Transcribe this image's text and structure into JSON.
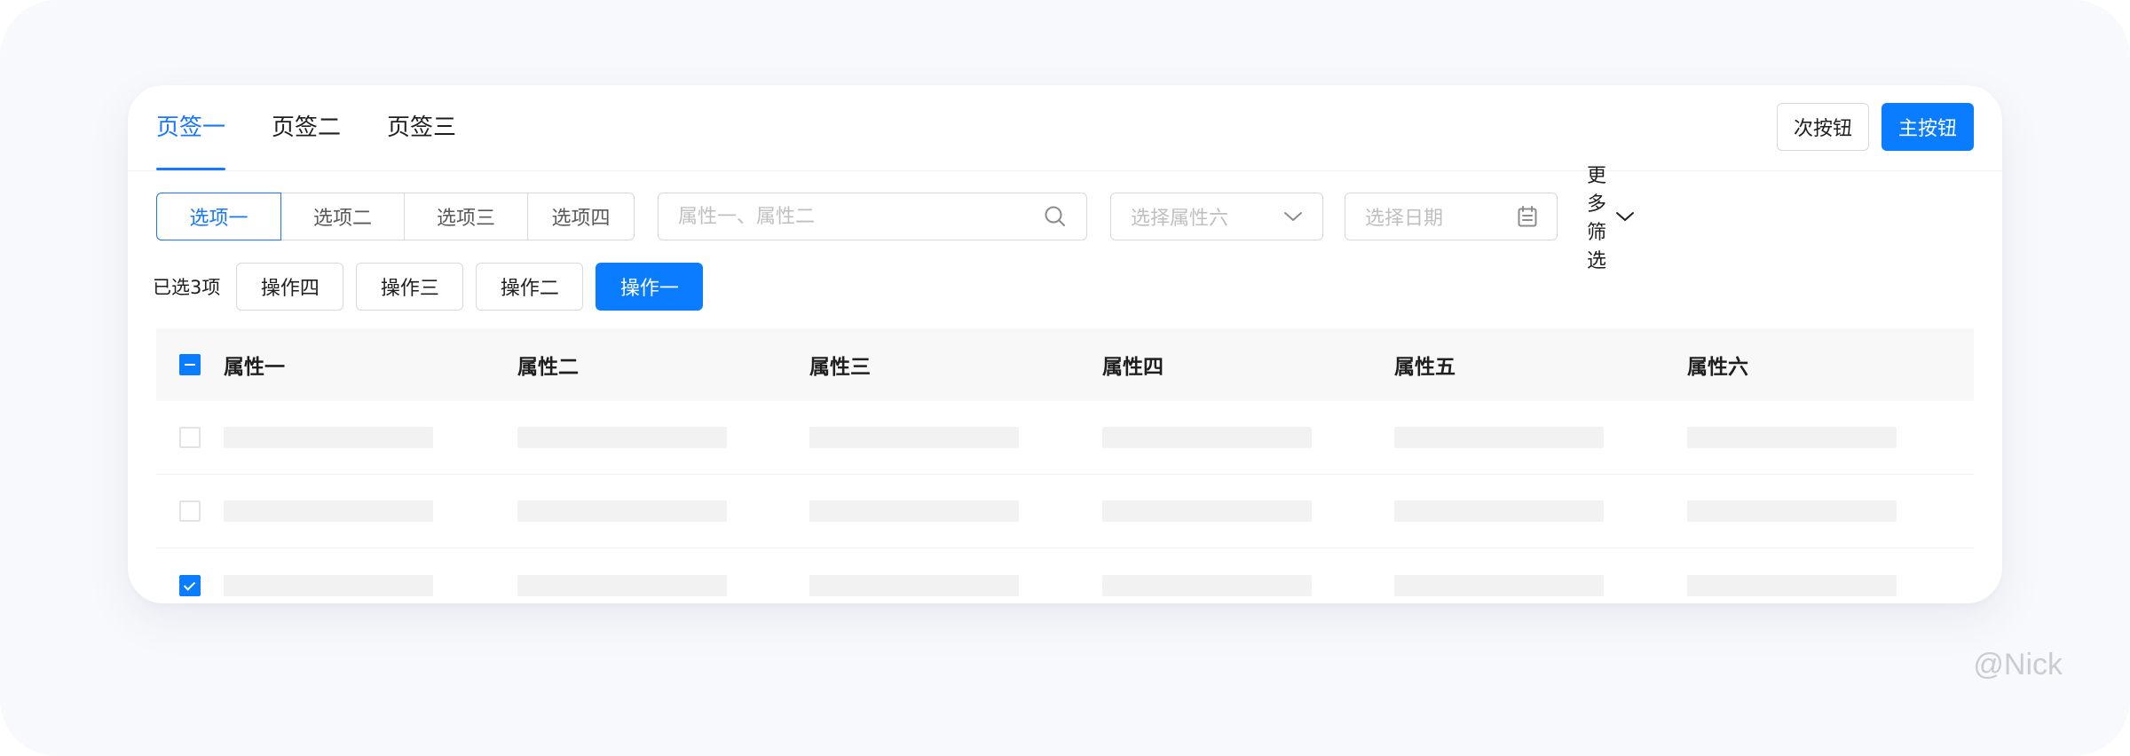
{
  "tabs": [
    {
      "label": "页签一",
      "active": true
    },
    {
      "label": "页签二",
      "active": false
    },
    {
      "label": "页签三",
      "active": false
    }
  ],
  "header_actions": {
    "secondary_label": "次按钮",
    "primary_label": "主按钮"
  },
  "filters": {
    "segments": [
      {
        "label": "选项一",
        "active": true
      },
      {
        "label": "选项二",
        "active": false
      },
      {
        "label": "选项三",
        "active": false
      },
      {
        "label": "选项四",
        "active": false
      }
    ],
    "search": {
      "placeholder": "属性一、属性二",
      "value": ""
    },
    "select": {
      "placeholder": "选择属性六"
    },
    "date": {
      "placeholder": "选择日期"
    },
    "more_label": "更多筛选"
  },
  "bulk": {
    "selected_text": "已选3项",
    "actions": [
      {
        "label": "操作四",
        "primary": false
      },
      {
        "label": "操作三",
        "primary": false
      },
      {
        "label": "操作二",
        "primary": false
      },
      {
        "label": "操作一",
        "primary": true
      }
    ]
  },
  "table": {
    "header_checkbox": "partial",
    "columns": [
      "属性一",
      "属性二",
      "属性三",
      "属性四",
      "属性五",
      "属性六"
    ],
    "rows": [
      {
        "checked": false
      },
      {
        "checked": false
      },
      {
        "checked": true
      }
    ]
  },
  "watermark": "@Nick",
  "colors": {
    "accent": "#1677ff",
    "primary_button": "#0a7cff",
    "border": "#d9d9d9",
    "placeholder": "#bfbfbf",
    "skeleton": "#f2f2f2"
  },
  "icons": {
    "search": "search-icon",
    "select": "chevron-down-icon",
    "date": "calendar-icon",
    "more": "chevron-down-icon"
  }
}
